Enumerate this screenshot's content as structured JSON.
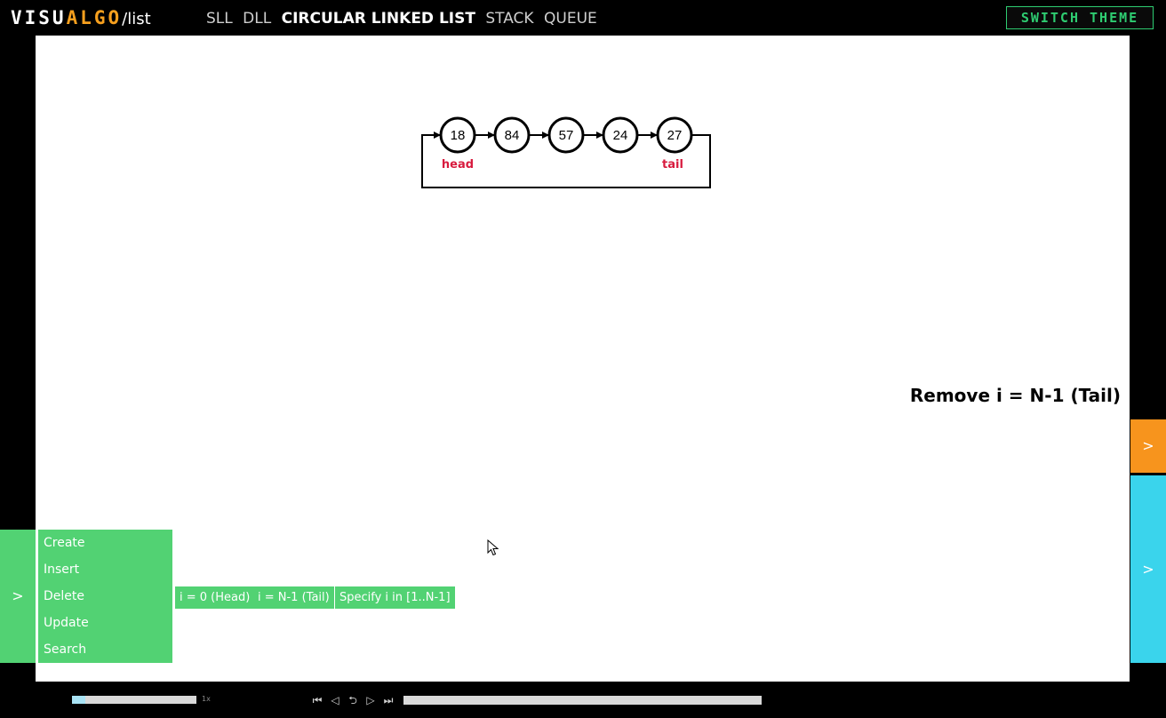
{
  "header": {
    "logo": {
      "part1": "VISU",
      "part2": "ALGO",
      "suffix": "/list"
    },
    "nav": [
      "SLL",
      "DLL",
      "CIRCULAR LINKED LIST",
      "STACK",
      "QUEUE"
    ],
    "active_nav": "CIRCULAR LINKED LIST",
    "switch_theme": "SWITCH THEME"
  },
  "viz": {
    "nodes": [
      "18",
      "84",
      "57",
      "24",
      "27"
    ],
    "head_label": "head",
    "tail_label": "tail",
    "status_text": "Remove i = N-1 (Tail)"
  },
  "side_tabs": {
    "status_toggle": ">",
    "codetrace_toggle": ">"
  },
  "actions": {
    "toggle": ">",
    "menu": [
      "Create",
      "Insert",
      "Delete",
      "Update",
      "Search"
    ],
    "delete_options": [
      "i = 0 (Head)",
      "i = N-1 (Tail)",
      "Specify i in [1..N-1]"
    ]
  },
  "controls": {
    "speed_label": "1x",
    "speed_fraction": 0.11,
    "media_icons": [
      "go-to-beginning-icon",
      "step-backward-icon",
      "repeat-icon",
      "step-forward-icon",
      "go-to-end-icon"
    ],
    "media_glyphs": [
      "⏮",
      "◁",
      "⮌",
      "▷",
      "⏭"
    ]
  },
  "colors": {
    "accent_green": "#52d273",
    "orange": "#f7941d",
    "cyan": "#3ad4ec",
    "logo_orange": "#f7a01e",
    "pointer_red": "#d81b3e"
  }
}
